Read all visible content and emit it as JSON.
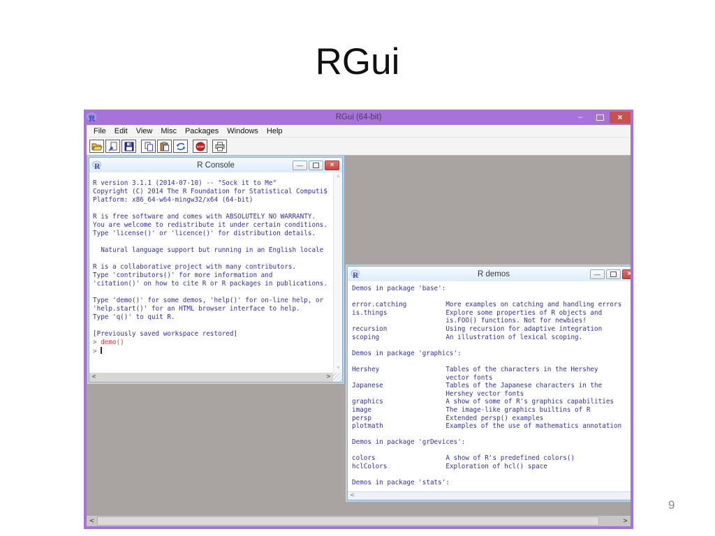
{
  "slide": {
    "title": "RGui",
    "page_number": "9"
  },
  "rgui": {
    "title": "RGui (64-bit)",
    "menu": [
      "File",
      "Edit",
      "View",
      "Misc",
      "Packages",
      "Windows",
      "Help"
    ],
    "toolbar_icons": [
      "open-script-icon",
      "load-workspace-icon",
      "save-icon",
      "copy-icon",
      "paste-icon",
      "copy-paste-icon",
      "stop-icon",
      "print-icon"
    ],
    "controls": {
      "minimize": "–",
      "close": "×"
    }
  },
  "console": {
    "title": "R Console",
    "output_lines": [
      "R version 3.1.1 (2014-07-10) -- \"Sock it to Me\"",
      "Copyright (C) 2014 The R Foundation for Statistical Computi$",
      "Platform: x86_64-w64-mingw32/x64 (64-bit)",
      "",
      "R is free software and comes with ABSOLUTELY NO WARRANTY.",
      "You are welcome to redistribute it under certain conditions.",
      "Type 'license()' or 'licence()' for distribution details.",
      "",
      "  Natural language support but running in an English locale",
      "",
      "R is a collaborative project with many contributors.",
      "Type 'contributors()' for more information and",
      "'citation()' on how to cite R or R packages in publications.",
      "",
      "Type 'demo()' for some demos, 'help()' for on-line help, or",
      "'help.start()' for an HTML browser interface to help.",
      "Type 'q()' to quit R.",
      "",
      "[Previously saved workspace restored]",
      ""
    ],
    "history_line": "> demo()",
    "prompt": "> ",
    "scroll": {
      "up": "▲",
      "down": "▼",
      "left": "<",
      "right": ">"
    }
  },
  "demos": {
    "title": "R demos",
    "lines": [
      "Demos in package 'base':",
      "",
      "error.catching          More examples on catching and handling errors",
      "is.things               Explore some properties of R objects and",
      "                        is.FOO() functions. Not for newbies!",
      "recursion               Using recursion for adaptive integration",
      "scoping                 An illustration of lexical scoping.",
      "",
      "Demos in package 'graphics':",
      "",
      "Hershey                 Tables of the characters in the Hershey",
      "                        vector fonts",
      "Japanese                Tables of the Japanese characters in the",
      "                        Hershey vector fonts",
      "graphics                A show of some of R's graphics capabilities",
      "image                   The image-like graphics builtins of R",
      "persp                   Extended persp() examples",
      "plotmath                Examples of the use of mathematics annotation",
      "",
      "Demos in package 'grDevices':",
      "",
      "colors                  A show of R's predefined colors()",
      "hclColors               Exploration of hcl() space",
      "",
      "Demos in package 'stats':"
    ],
    "scroll": {
      "left": "<"
    }
  },
  "mdi_scrollbar": {
    "left": "<",
    "right": ">"
  },
  "colors": {
    "frame_purple": "#a873d8",
    "close_red": "#c75050",
    "console_text_blue": "#32329b",
    "console_input_red": "#cc4040",
    "mdi_gray": "#a7a4a2",
    "child_border_blue": "#b9d5ea"
  }
}
